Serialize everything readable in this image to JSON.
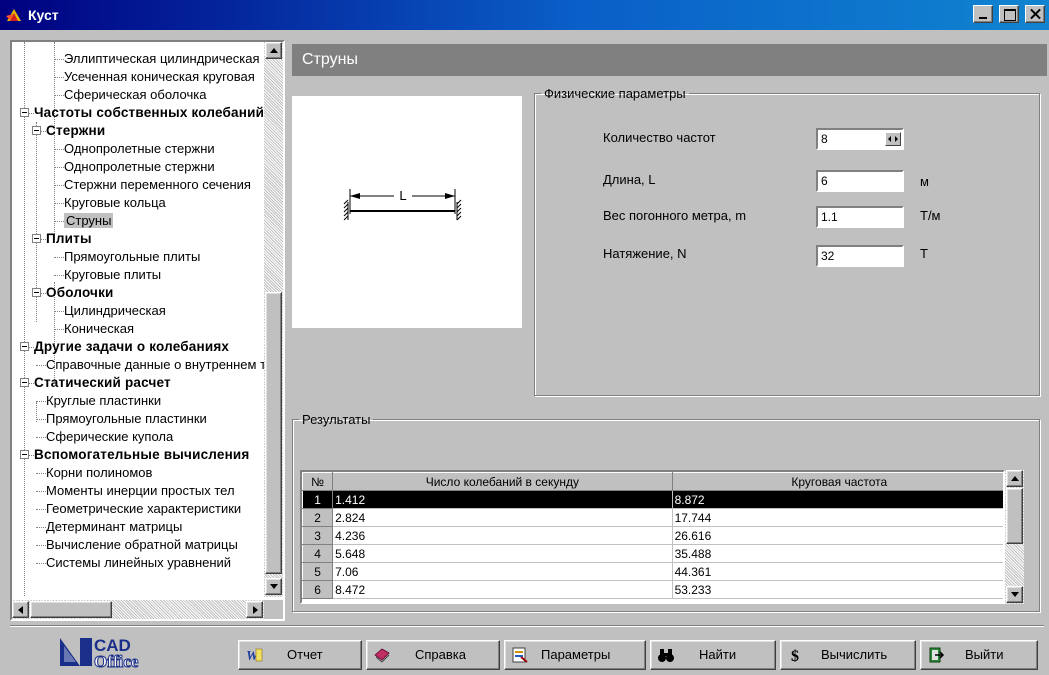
{
  "window": {
    "title": "Куст"
  },
  "tree": {
    "items": [
      {
        "label": "Эллиптическая цилиндрическая",
        "level": 2
      },
      {
        "label": "Усеченная коническая круговая",
        "level": 2
      },
      {
        "label": "Сферическая оболочка",
        "level": 2
      },
      {
        "label": "Частоты собственных колебаний",
        "level": 0,
        "bold": true,
        "expanded": true
      },
      {
        "label": "Стержни",
        "level": 1,
        "bold": true,
        "expanded": true
      },
      {
        "label": "Однопролетные стержни",
        "level": 2
      },
      {
        "label": "Однопролетные стержни",
        "level": 2
      },
      {
        "label": "Стержни переменного сечения",
        "level": 2
      },
      {
        "label": "Круговые кольца",
        "level": 2
      },
      {
        "label": "Струны",
        "level": 2,
        "selected": true
      },
      {
        "label": "Плиты",
        "level": 1,
        "bold": true,
        "expanded": true
      },
      {
        "label": "Прямоугольные плиты",
        "level": 2
      },
      {
        "label": "Круговые плиты",
        "level": 2
      },
      {
        "label": "Оболочки",
        "level": 1,
        "bold": true,
        "expanded": true
      },
      {
        "label": "Цилиндрическая",
        "level": 2
      },
      {
        "label": "Коническая",
        "level": 2
      },
      {
        "label": "Другие задачи о колебаниях",
        "level": 0,
        "bold": true,
        "expanded": true
      },
      {
        "label": "Справочные данные о внутреннем трении",
        "level": 1
      },
      {
        "label": "Статический расчет",
        "level": 0,
        "bold": true,
        "expanded": true
      },
      {
        "label": "Круглые пластинки",
        "level": 1
      },
      {
        "label": "Прямоугольные пластинки",
        "level": 1
      },
      {
        "label": "Сферические купола",
        "level": 1
      },
      {
        "label": "Вспомогательные вычисления",
        "level": 0,
        "bold": true,
        "expanded": true
      },
      {
        "label": "Корни полиномов",
        "level": 1
      },
      {
        "label": "Моменты инерции простых тел",
        "level": 1
      },
      {
        "label": "Геометрические характеристики",
        "level": 1
      },
      {
        "label": "Детерминант матрицы",
        "level": 1
      },
      {
        "label": "Вычисление обратной матрицы",
        "level": 1
      },
      {
        "label": "Системы линейных уравнений",
        "level": 1
      }
    ]
  },
  "content": {
    "header": "Струны",
    "diagram_label": "L"
  },
  "params": {
    "legend": "Физические параметры",
    "freq_count_label": "Количество частот",
    "freq_count_value": "8",
    "length_label": "Длина, L",
    "length_value": "6",
    "length_unit": "м",
    "weight_label": "Вес погонного метра, m",
    "weight_value": "1.1",
    "weight_unit": "Т/м",
    "tension_label": "Натяжение, N",
    "tension_value": "32",
    "tension_unit": "Т"
  },
  "results": {
    "legend": "Результаты",
    "columns": [
      "№",
      "Число колебаний в секунду",
      "Круговая частота"
    ],
    "rows": [
      [
        "1",
        "1.412",
        "8.872"
      ],
      [
        "2",
        "2.824",
        "17.744"
      ],
      [
        "3",
        "4.236",
        "26.616"
      ],
      [
        "4",
        "5.648",
        "35.488"
      ],
      [
        "5",
        "7.06",
        "44.361"
      ],
      [
        "6",
        "8.472",
        "53.233"
      ]
    ],
    "selected_row": 0
  },
  "toolbar": {
    "logo_top": "CAD",
    "logo_bottom": "Office",
    "report": "Отчет",
    "help": "Справка",
    "parameters": "Параметры",
    "find": "Найти",
    "calculate": "Вычислить",
    "exit": "Выйти"
  },
  "colors": {
    "title_bar": "#000080",
    "header_bar": "#808080",
    "selection": "#000000",
    "face": "#c0c0c0"
  }
}
